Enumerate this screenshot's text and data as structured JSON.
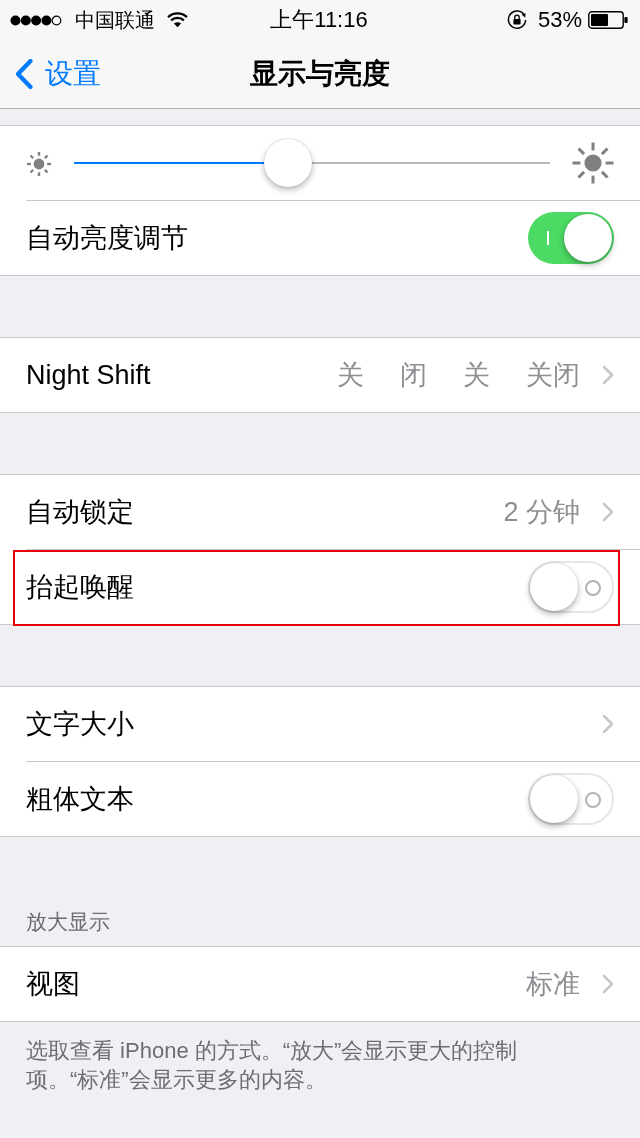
{
  "status_bar": {
    "carrier": "中国联通",
    "time": "上午11:16",
    "battery": "53%"
  },
  "nav": {
    "back": "设置",
    "title": "显示与亮度"
  },
  "groups": [
    {
      "rows": [
        {
          "kind": "slider",
          "level": 0.45
        },
        {
          "kind": "toggle",
          "label": "自动亮度调节",
          "on": true
        }
      ]
    },
    {
      "rows": [
        {
          "kind": "detail",
          "label": "Night Shift",
          "values": [
            "关",
            "闭",
            "关",
            "关闭"
          ]
        }
      ]
    },
    {
      "rows": [
        {
          "kind": "detail",
          "label": "自动锁定",
          "values": [
            "2 分钟"
          ]
        },
        {
          "kind": "toggle",
          "label": "抬起唤醒",
          "on": false,
          "highlighted": true
        }
      ]
    },
    {
      "rows": [
        {
          "kind": "detail",
          "label": "文字大小"
        },
        {
          "kind": "toggle",
          "label": "粗体文本",
          "on": false
        }
      ]
    },
    {
      "header": "放大显示",
      "rows": [
        {
          "kind": "detail",
          "label": "视图",
          "values": [
            "标准"
          ]
        }
      ],
      "footer": "选取查看 iPhone 的方式。“放大”会显示更大的控制项。“标准”会显示更多的内容。"
    }
  ]
}
